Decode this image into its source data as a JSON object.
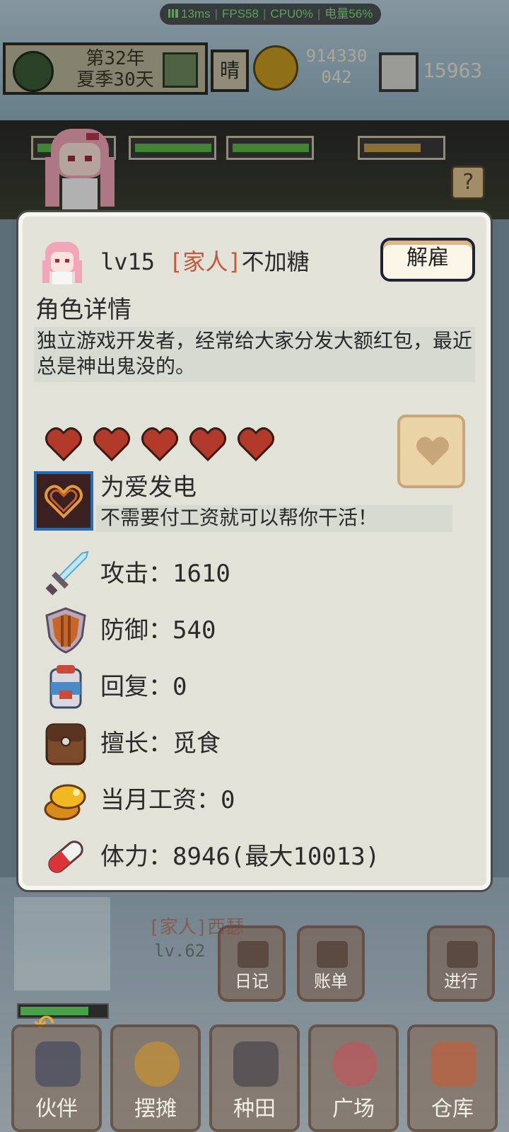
{
  "status_bar": {
    "ping": "13ms",
    "fps": "FPS58",
    "cpu": "CPU0%",
    "battery": "电量56%"
  },
  "hud": {
    "year": "第32年",
    "season_day": "夏季30天",
    "weather": "晴",
    "money_line1": "914330",
    "money_line2": "042",
    "gems": "15963"
  },
  "modal": {
    "level": "lv15",
    "tag": "[家人]",
    "name": "不加糖",
    "fire_button": "解雇",
    "section_title": "角色详情",
    "description": "独立游戏开发者，经常给大家分发大额红包，最近总是神出鬼没的。",
    "affection": {
      "filled": 5,
      "max": 5
    },
    "trait": {
      "name": "为爱发电",
      "description": "不需要付工资就可以帮你干活！"
    },
    "stats": [
      {
        "icon": "sword-icon",
        "label": "攻击：1610"
      },
      {
        "icon": "shield-icon",
        "label": "防御：540"
      },
      {
        "icon": "backpack-icon",
        "label": "回复：0"
      },
      {
        "icon": "bag-icon",
        "label": "擅长：觅食"
      },
      {
        "icon": "coins-icon",
        "label": "当月工资：0"
      },
      {
        "icon": "pill-icon",
        "label": "体力：8946(最大10013)"
      }
    ]
  },
  "bottom": {
    "companion_tag": "[家人]西瑟",
    "companion_level": "lv.62",
    "actions": [
      "日记",
      "账单",
      "进行"
    ],
    "nav": [
      "伙伴",
      "摆摊",
      "种田",
      "广场",
      "仓库"
    ]
  },
  "colors": {
    "panel": "#e2e2d8",
    "tag": "#c5573c",
    "heart": "#b23a2a",
    "accent_blue": "#2a6ab0"
  }
}
